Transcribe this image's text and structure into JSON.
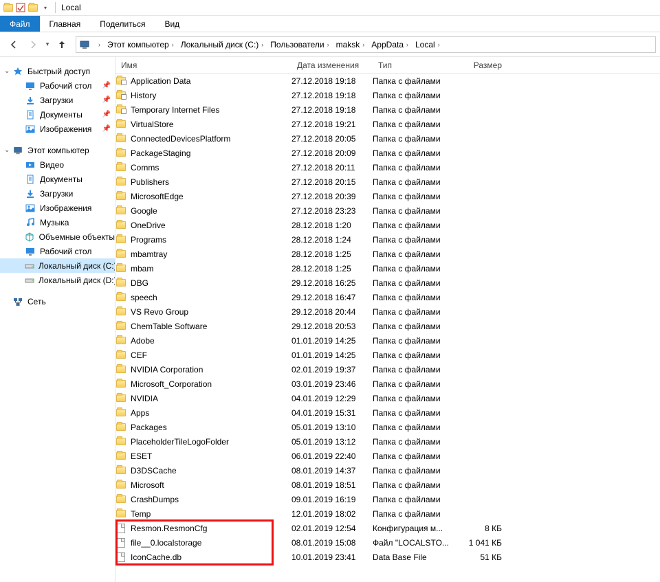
{
  "titlebar": {
    "title": "Local"
  },
  "ribbon": {
    "tabs": [
      {
        "label": "Файл",
        "active": true
      },
      {
        "label": "Главная",
        "active": false
      },
      {
        "label": "Поделиться",
        "active": false
      },
      {
        "label": "Вид",
        "active": false
      }
    ]
  },
  "breadcrumb": [
    "Этот компьютер",
    "Локальный диск (C:)",
    "Пользователи",
    "maksk",
    "AppData",
    "Local"
  ],
  "columns": {
    "name": "Имя",
    "date": "Дата изменения",
    "type": "Тип",
    "size": "Размер"
  },
  "nav": {
    "quick": {
      "label": "Быстрый доступ",
      "items": [
        {
          "label": "Рабочий стол",
          "icon": "desktop"
        },
        {
          "label": "Загрузки",
          "icon": "downloads"
        },
        {
          "label": "Документы",
          "icon": "documents"
        },
        {
          "label": "Изображения",
          "icon": "pictures"
        }
      ]
    },
    "pc": {
      "label": "Этот компьютер",
      "items": [
        {
          "label": "Видео",
          "icon": "video"
        },
        {
          "label": "Документы",
          "icon": "documents"
        },
        {
          "label": "Загрузки",
          "icon": "downloads"
        },
        {
          "label": "Изображения",
          "icon": "pictures"
        },
        {
          "label": "Музыка",
          "icon": "music"
        },
        {
          "label": "Объемные объекты",
          "icon": "objects3d"
        },
        {
          "label": "Рабочий стол",
          "icon": "desktop"
        },
        {
          "label": "Локальный диск (C:)",
          "icon": "drive",
          "selected": true
        },
        {
          "label": "Локальный диск (D:)",
          "icon": "drive"
        }
      ]
    },
    "network": {
      "label": "Сеть"
    }
  },
  "rows": [
    {
      "name": "Application Data",
      "date": "27.12.2018 19:18",
      "type": "Папка с файлами",
      "size": "",
      "icon": "folder-link"
    },
    {
      "name": "History",
      "date": "27.12.2018 19:18",
      "type": "Папка с файлами",
      "size": "",
      "icon": "folder-link"
    },
    {
      "name": "Temporary Internet Files",
      "date": "27.12.2018 19:18",
      "type": "Папка с файлами",
      "size": "",
      "icon": "folder-link"
    },
    {
      "name": "VirtualStore",
      "date": "27.12.2018 19:21",
      "type": "Папка с файлами",
      "size": "",
      "icon": "folder"
    },
    {
      "name": "ConnectedDevicesPlatform",
      "date": "27.12.2018 20:05",
      "type": "Папка с файлами",
      "size": "",
      "icon": "folder"
    },
    {
      "name": "PackageStaging",
      "date": "27.12.2018 20:09",
      "type": "Папка с файлами",
      "size": "",
      "icon": "folder"
    },
    {
      "name": "Comms",
      "date": "27.12.2018 20:11",
      "type": "Папка с файлами",
      "size": "",
      "icon": "folder"
    },
    {
      "name": "Publishers",
      "date": "27.12.2018 20:15",
      "type": "Папка с файлами",
      "size": "",
      "icon": "folder"
    },
    {
      "name": "MicrosoftEdge",
      "date": "27.12.2018 20:39",
      "type": "Папка с файлами",
      "size": "",
      "icon": "folder"
    },
    {
      "name": "Google",
      "date": "27.12.2018 23:23",
      "type": "Папка с файлами",
      "size": "",
      "icon": "folder"
    },
    {
      "name": "OneDrive",
      "date": "28.12.2018 1:20",
      "type": "Папка с файлами",
      "size": "",
      "icon": "folder"
    },
    {
      "name": "Programs",
      "date": "28.12.2018 1:24",
      "type": "Папка с файлами",
      "size": "",
      "icon": "folder"
    },
    {
      "name": "mbamtray",
      "date": "28.12.2018 1:25",
      "type": "Папка с файлами",
      "size": "",
      "icon": "folder"
    },
    {
      "name": "mbam",
      "date": "28.12.2018 1:25",
      "type": "Папка с файлами",
      "size": "",
      "icon": "folder"
    },
    {
      "name": "DBG",
      "date": "29.12.2018 16:25",
      "type": "Папка с файлами",
      "size": "",
      "icon": "folder"
    },
    {
      "name": "speech",
      "date": "29.12.2018 16:47",
      "type": "Папка с файлами",
      "size": "",
      "icon": "folder"
    },
    {
      "name": "VS Revo Group",
      "date": "29.12.2018 20:44",
      "type": "Папка с файлами",
      "size": "",
      "icon": "folder"
    },
    {
      "name": "ChemTable Software",
      "date": "29.12.2018 20:53",
      "type": "Папка с файлами",
      "size": "",
      "icon": "folder"
    },
    {
      "name": "Adobe",
      "date": "01.01.2019 14:25",
      "type": "Папка с файлами",
      "size": "",
      "icon": "folder"
    },
    {
      "name": "CEF",
      "date": "01.01.2019 14:25",
      "type": "Папка с файлами",
      "size": "",
      "icon": "folder"
    },
    {
      "name": "NVIDIA Corporation",
      "date": "02.01.2019 19:37",
      "type": "Папка с файлами",
      "size": "",
      "icon": "folder"
    },
    {
      "name": "Microsoft_Corporation",
      "date": "03.01.2019 23:46",
      "type": "Папка с файлами",
      "size": "",
      "icon": "folder"
    },
    {
      "name": "NVIDIA",
      "date": "04.01.2019 12:29",
      "type": "Папка с файлами",
      "size": "",
      "icon": "folder"
    },
    {
      "name": "Apps",
      "date": "04.01.2019 15:31",
      "type": "Папка с файлами",
      "size": "",
      "icon": "folder"
    },
    {
      "name": "Packages",
      "date": "05.01.2019 13:10",
      "type": "Папка с файлами",
      "size": "",
      "icon": "folder"
    },
    {
      "name": "PlaceholderTileLogoFolder",
      "date": "05.01.2019 13:12",
      "type": "Папка с файлами",
      "size": "",
      "icon": "folder"
    },
    {
      "name": "ESET",
      "date": "06.01.2019 22:40",
      "type": "Папка с файлами",
      "size": "",
      "icon": "folder"
    },
    {
      "name": "D3DSCache",
      "date": "08.01.2019 14:37",
      "type": "Папка с файлами",
      "size": "",
      "icon": "folder"
    },
    {
      "name": "Microsoft",
      "date": "08.01.2019 18:51",
      "type": "Папка с файлами",
      "size": "",
      "icon": "folder"
    },
    {
      "name": "CrashDumps",
      "date": "09.01.2019 16:19",
      "type": "Папка с файлами",
      "size": "",
      "icon": "folder"
    },
    {
      "name": "Temp",
      "date": "12.01.2019 18:02",
      "type": "Папка с файлами",
      "size": "",
      "icon": "folder"
    },
    {
      "name": "Resmon.ResmonCfg",
      "date": "02.01.2019 12:54",
      "type": "Конфигурация м...",
      "size": "8 КБ",
      "icon": "file"
    },
    {
      "name": "file__0.localstorage",
      "date": "08.01.2019 15:08",
      "type": "Файл \"LOCALSTO...",
      "size": "1 041 КБ",
      "icon": "file"
    },
    {
      "name": "IconCache.db",
      "date": "10.01.2019 23:41",
      "type": "Data Base File",
      "size": "51 КБ",
      "icon": "file"
    }
  ],
  "highlight": {
    "start": 31,
    "end": 33
  }
}
